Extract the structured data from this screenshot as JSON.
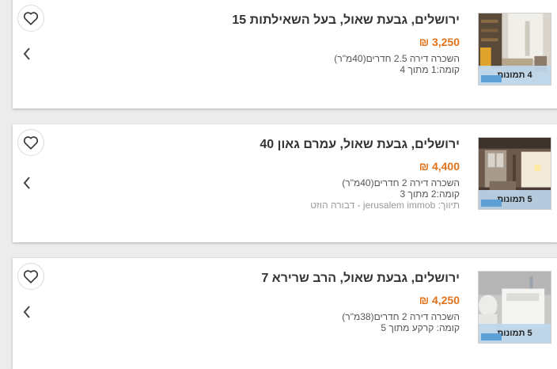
{
  "colors": {
    "price": "#e0721c",
    "badge_bg": "#bed7eb",
    "card_bg": "#ffffff",
    "page_bg": "#ececec"
  },
  "icons": {
    "favorite": "heart-icon",
    "navigate": "chevron-left-icon"
  },
  "listings": [
    {
      "address": "ירושלים, גבעת שאול, בעל השאילתות 15",
      "price": "3,250 ₪",
      "details": "השכרה דירה 2.5 חדרים(40מ\"ר)",
      "floor": "קומה:1 מתוך 4",
      "agent": "",
      "photos_label": "4 תמונות"
    },
    {
      "address": "ירושלים, גבעת שאול, עמרם גאון 40",
      "price": "4,400 ₪",
      "details": "השכרה דירה 2 חדרים(40מ\"ר)",
      "floor": "קומה:2 מתוך 3",
      "agent": "תיווך: jerusalem immob - דבורה הוזט",
      "photos_label": "5 תמונות"
    },
    {
      "address": "ירושלים, גבעת שאול, הרב שרירא 7",
      "price": "4,250 ₪",
      "details": "השכרה דירה 2 חדרים(38מ\"ר)",
      "floor": "קומה: קרקע מתוך 5",
      "agent": "",
      "photos_label": "5 תמונות"
    }
  ]
}
